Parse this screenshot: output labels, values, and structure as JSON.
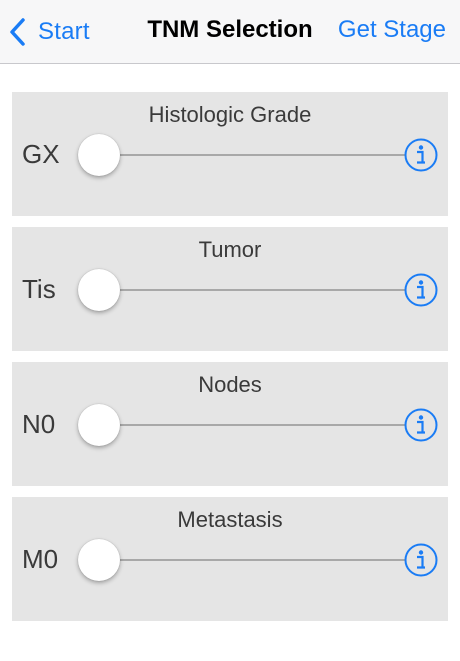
{
  "navbar": {
    "back_label": "Start",
    "title": "TNM Selection",
    "right_action": "Get Stage"
  },
  "sections": [
    {
      "title": "Histologic Grade",
      "value": "GX",
      "slider_level": 0
    },
    {
      "title": "Tumor",
      "value": "Tis",
      "slider_level": 0
    },
    {
      "title": "Nodes",
      "value": "N0",
      "slider_level": 0
    },
    {
      "title": "Metastasis",
      "value": "M0",
      "slider_level": 0
    }
  ],
  "colors": {
    "accent": "#1a7cf5",
    "section_bg": "#e5e5e5",
    "track": "#a8a8a8"
  },
  "icons": {
    "back": "chevron-left-icon",
    "info": "info-circle-icon"
  }
}
